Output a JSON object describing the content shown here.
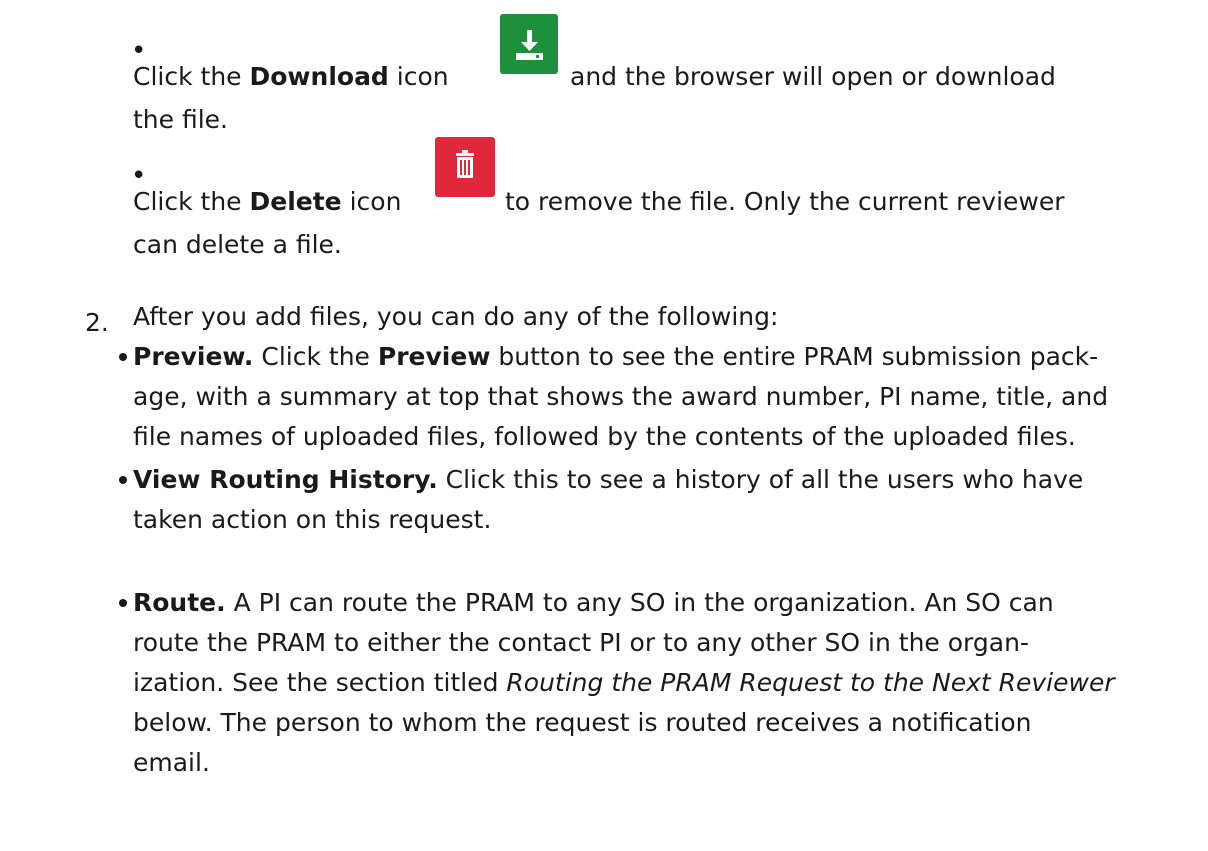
{
  "subitems": [
    {
      "pre": "Click the ",
      "term": "Download",
      "mid": " icon",
      "icon": "download-icon",
      "post1": "and the browser will open or download",
      "post2": "the file."
    },
    {
      "pre": "Click the ",
      "term": "Delete",
      "mid": " icon",
      "icon": "trash-icon",
      "post1": "to remove the file. Only the current reviewer",
      "post2": "can delete a file."
    }
  ],
  "step": {
    "number": "2.",
    "text": "After you add files, you can do any of the following:"
  },
  "options": [
    {
      "term": "Preview.",
      "text_a": " Click the ",
      "term2": "Preview",
      "text_b": " button to see the entire PRAM submission pack-",
      "line2": "age, with a summary at top that shows the award number, PI name, title, and",
      "line3": "file names of uploaded files, followed by the contents of the uploaded files."
    },
    {
      "term": "View Routing History.",
      "text": " Click this to see a history of all the users who have",
      "line2": "taken action on this request."
    },
    {
      "term": "Route.",
      "text": " A PI can route the PRAM to any SO in the organization. An SO can",
      "line2": "route the PRAM to either the contact PI or to any other SO in the organ-",
      "line3_pre": "ization. See the section titled ",
      "line3_italic": "Routing the PRAM Request to the Next Reviewer",
      "line4": "below. The person to whom the request is routed receives a notification",
      "line5": "email."
    }
  ],
  "colors": {
    "download_icon": "#1e8f3a",
    "delete_icon": "#e0283c",
    "text": "#1a1a1a"
  }
}
